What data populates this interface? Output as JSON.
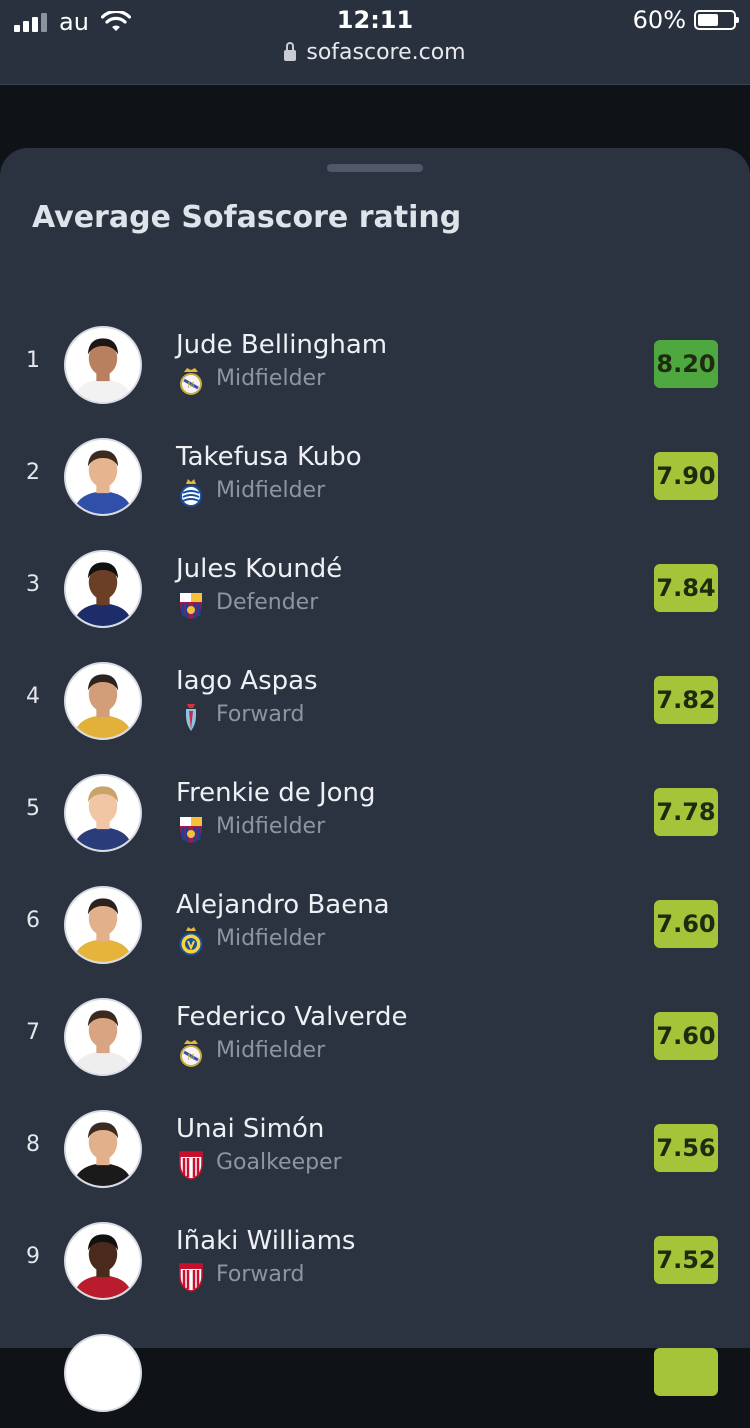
{
  "status": {
    "carrier": "au",
    "time": "12:11",
    "url": "sofascore.com",
    "battery": "60%",
    "battery_level": 0.6
  },
  "sheet": {
    "title": "Average Sofascore rating"
  },
  "colors": {
    "rating_top": "#4fa83f",
    "rating_high": "#a6c43a",
    "sheet_bg": "#2c3340"
  },
  "players": [
    {
      "rank": "1",
      "name": "Jude Bellingham",
      "position": "Midfielder",
      "rating": "8.20",
      "club_icon": "real-madrid-crest-icon",
      "tier": "top"
    },
    {
      "rank": "2",
      "name": "Takefusa Kubo",
      "position": "Midfielder",
      "rating": "7.90",
      "club_icon": "real-sociedad-crest-icon",
      "tier": "high"
    },
    {
      "rank": "3",
      "name": "Jules Koundé",
      "position": "Defender",
      "rating": "7.84",
      "club_icon": "barcelona-crest-icon",
      "tier": "high"
    },
    {
      "rank": "4",
      "name": "Iago Aspas",
      "position": "Forward",
      "rating": "7.82",
      "club_icon": "celta-crest-icon",
      "tier": "high"
    },
    {
      "rank": "5",
      "name": "Frenkie de Jong",
      "position": "Midfielder",
      "rating": "7.78",
      "club_icon": "barcelona-crest-icon",
      "tier": "high"
    },
    {
      "rank": "6",
      "name": "Alejandro Baena",
      "position": "Midfielder",
      "rating": "7.60",
      "club_icon": "villarreal-crest-icon",
      "tier": "high"
    },
    {
      "rank": "7",
      "name": "Federico Valverde",
      "position": "Midfielder",
      "rating": "7.60",
      "club_icon": "real-madrid-crest-icon",
      "tier": "high"
    },
    {
      "rank": "8",
      "name": "Unai Simón",
      "position": "Goalkeeper",
      "rating": "7.56",
      "club_icon": "athletic-club-crest-icon",
      "tier": "high"
    },
    {
      "rank": "9",
      "name": "Iñaki Williams",
      "position": "Forward",
      "rating": "7.52",
      "club_icon": "athletic-club-crest-icon",
      "tier": "high"
    }
  ]
}
